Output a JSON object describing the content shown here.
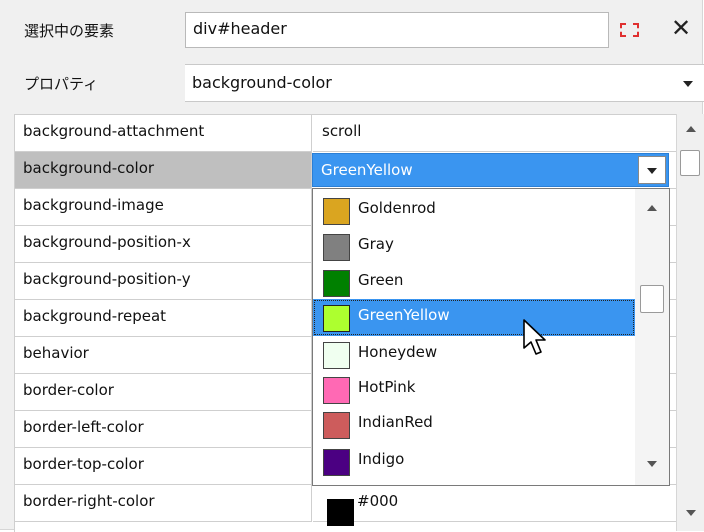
{
  "header": {
    "element_label": "選択中の要素",
    "element_value": "div#header",
    "property_label": "プロパティ",
    "property_value": "background-color"
  },
  "grid": {
    "rows": [
      {
        "name": "background-attachment",
        "value": "scroll"
      },
      {
        "name": "background-color",
        "value": "GreenYellow"
      },
      {
        "name": "background-image",
        "value": ""
      },
      {
        "name": "background-position-x",
        "value": ""
      },
      {
        "name": "background-position-y",
        "value": ""
      },
      {
        "name": "background-repeat",
        "value": ""
      },
      {
        "name": "behavior",
        "value": ""
      },
      {
        "name": "border-color",
        "value": ""
      },
      {
        "name": "border-left-color",
        "value": ""
      },
      {
        "name": "border-top-color",
        "value": ""
      },
      {
        "name": "border-right-color",
        "value": "#000"
      }
    ]
  },
  "dropdown": {
    "selected": "GreenYellow",
    "options": [
      {
        "label": "Goldenrod",
        "color": "#DAA520"
      },
      {
        "label": "Gray",
        "color": "#808080"
      },
      {
        "label": "Green",
        "color": "#008000"
      },
      {
        "label": "GreenYellow",
        "color": "#ADFF2F"
      },
      {
        "label": "Honeydew",
        "color": "#F0FFF0"
      },
      {
        "label": "HotPink",
        "color": "#FF69B4"
      },
      {
        "label": "IndianRed",
        "color": "#CD5C5C"
      },
      {
        "label": "Indigo",
        "color": "#4B0082"
      }
    ]
  },
  "icons": {
    "pick": "element-picker-icon",
    "close": "close-icon"
  }
}
